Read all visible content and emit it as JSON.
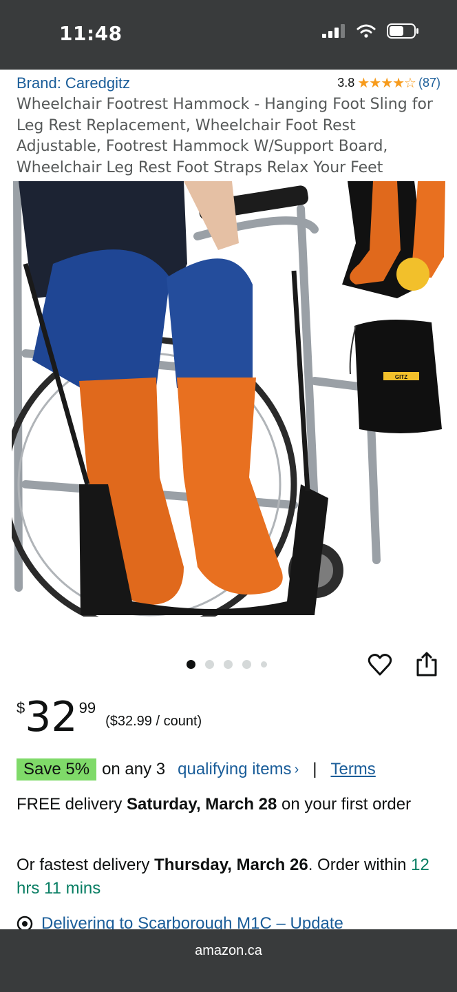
{
  "status_bar": {
    "time": "11:48"
  },
  "product": {
    "brand": "Brand: Caredgitz",
    "rating_value": "3.8",
    "rating_stars": 3.8,
    "rating_count": "(87)",
    "title": "Wheelchair Footrest Hammock - Hanging Foot Sling for Leg Rest Replacement, Wheelchair Foot Rest Adjustable, Footrest Hammock W/Support Board, Wheelchair Leg Rest Foot Straps Relax Your Feet",
    "image_count": 5,
    "active_image": 1,
    "bag_label": "GITZ"
  },
  "price": {
    "currency": "$",
    "whole": "32",
    "fraction": "99",
    "per_unit": "($32.99 / count)"
  },
  "promo": {
    "badge": "Save 5%",
    "text": "on any 3",
    "link": "qualifying items",
    "terms": "Terms"
  },
  "delivery": {
    "prefix": "FREE delivery ",
    "date": "Saturday, March 28",
    "suffix": " on your first order"
  },
  "fastest": {
    "prefix": "Or fastest delivery ",
    "date": "Thursday, March 26",
    "mid": ". Order within ",
    "countdown": "12 hrs 11 mins"
  },
  "location": {
    "text": "Delivering to Scarborough M1C – Update"
  },
  "browser": {
    "domain": "amazon.ca"
  },
  "colors": {
    "link": "#1a5d99",
    "star": "#f79b1c",
    "badge": "#7fda69",
    "countdown": "#067d62",
    "chrome": "#393b3c"
  }
}
